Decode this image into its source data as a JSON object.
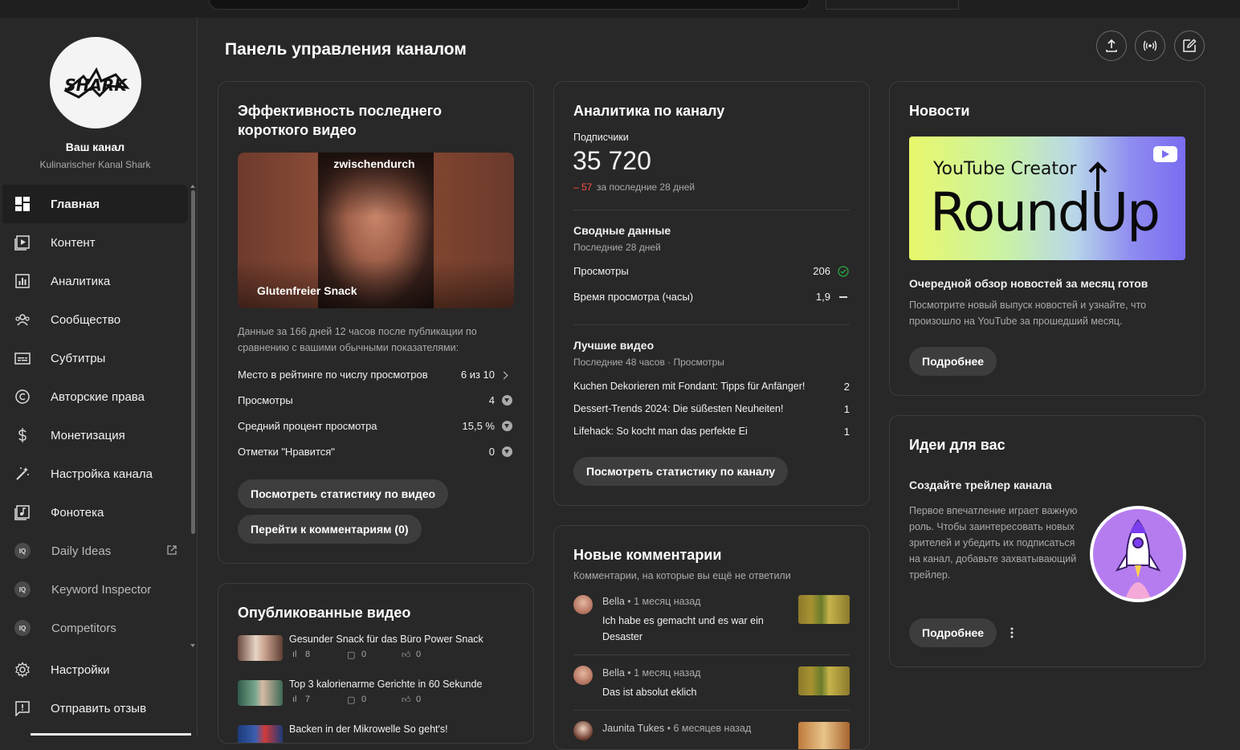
{
  "sidebar": {
    "channel_title": "Ваш канал",
    "channel_name": "Kulinarischer Kanal Shark",
    "logo_text": "SHARK",
    "items": [
      {
        "label": "Главная",
        "icon": "dashboard-icon"
      },
      {
        "label": "Контент",
        "icon": "video-library-icon"
      },
      {
        "label": "Аналитика",
        "icon": "analytics-icon"
      },
      {
        "label": "Сообщество",
        "icon": "community-icon"
      },
      {
        "label": "Субтитры",
        "icon": "subtitles-icon"
      },
      {
        "label": "Авторские права",
        "icon": "copyright-icon"
      },
      {
        "label": "Монетизация",
        "icon": "dollar-icon"
      },
      {
        "label": "Настройка канала",
        "icon": "magic-wand-icon"
      },
      {
        "label": "Фонотека",
        "icon": "music-icon"
      },
      {
        "label": "Daily Ideas",
        "icon": "extension-icon"
      },
      {
        "label": "Keyword Inspector",
        "icon": "extension-icon"
      },
      {
        "label": "Competitors",
        "icon": "extension-icon"
      }
    ],
    "settings_label": "Настройки",
    "feedback_label": "Отправить отзыв"
  },
  "header": {
    "title": "Панель управления каналом"
  },
  "short_card": {
    "title": "Эффективность последнего короткого видео",
    "thumb_top_text": "zwischendurch",
    "thumb_bottom_text": "Glutenfreier Snack",
    "description": "Данные за 166 дней 12 часов после публикации по сравнению с вашими обычными показателями:",
    "rows": [
      {
        "label": "Место в рейтинге по числу просмотров",
        "value": "6 из 10"
      },
      {
        "label": "Просмотры",
        "value": "4"
      },
      {
        "label": "Средний процент просмотра",
        "value": "15,5 %"
      },
      {
        "label": "Отметки \"Нравится\"",
        "value": "0"
      }
    ],
    "btn_stats": "Посмотреть статистику по видео",
    "btn_comments": "Перейти к комментариям (0)"
  },
  "published_card": {
    "title": "Опубликованные видео",
    "videos": [
      {
        "title": "Gesunder Snack für das Büro Power Snack",
        "views": "8",
        "comments": "0",
        "likes": "0"
      },
      {
        "title": "Top 3 kalorienarme Gerichte in 60 Sekunde",
        "views": "7",
        "comments": "0",
        "likes": "0"
      },
      {
        "title": "Backen in der Mikrowelle So geht's!"
      }
    ]
  },
  "analytics_card": {
    "title": "Аналитика по каналу",
    "subs_label": "Подписчики",
    "subs_value": "35 720",
    "subs_change": "– 57",
    "subs_change_suffix": "за последние 28 дней",
    "summary_title": "Сводные данные",
    "summary_period": "Последние 28 дней",
    "views_label": "Просмотры",
    "views_value": "206",
    "watch_label": "Время просмотра (часы)",
    "watch_value": "1,9",
    "top_title": "Лучшие видео",
    "top_period": "Последние 48 часов · Просмотры",
    "top_videos": [
      {
        "title": "Kuchen Dekorieren mit Fondant: Tipps für Anfänger!",
        "views": "2"
      },
      {
        "title": "Dessert-Trends 2024: Die süßesten Neuheiten!",
        "views": "1"
      },
      {
        "title": "Lifehack: So kocht man das perfekte Ei",
        "views": "1"
      }
    ],
    "btn": "Посмотреть статистику по каналу"
  },
  "comments_card": {
    "title": "Новые комментарии",
    "subtitle": "Комментарии, на которые вы ещё не ответили",
    "comments": [
      {
        "author": "Bella",
        "time": "1 месяц назад",
        "text": "Ich habe es gemacht und es war ein Desaster"
      },
      {
        "author": "Bella",
        "time": "1 месяц назад",
        "text": "Das ist absolut eklich"
      },
      {
        "author": "Jaunita Tukes",
        "time": "6 месяцев назад",
        "text": ""
      }
    ]
  },
  "news_card": {
    "title": "Новости",
    "img_line1": "YouTube Creator",
    "img_line2": "RoundUp",
    "headline": "Очередной обзор новостей за месяц готов",
    "text": "Посмотрите новый выпуск новостей и узнайте, что произошло на YouTube за прошедший месяц.",
    "btn": "Подробнее"
  },
  "ideas_card": {
    "title": "Идеи для вас",
    "headline": "Создайте трейлер канала",
    "text": "Первое впечатление играет важную роль. Чтобы заинтересовать новых зрителей и убедить их подписаться на канал, добавьте захватывающий трейлер.",
    "btn": "Подробнее"
  },
  "colors": {
    "background": "#282828",
    "card_border": "#3d3d3d",
    "negative": "#ff4e45",
    "positive": "#2ba640"
  }
}
